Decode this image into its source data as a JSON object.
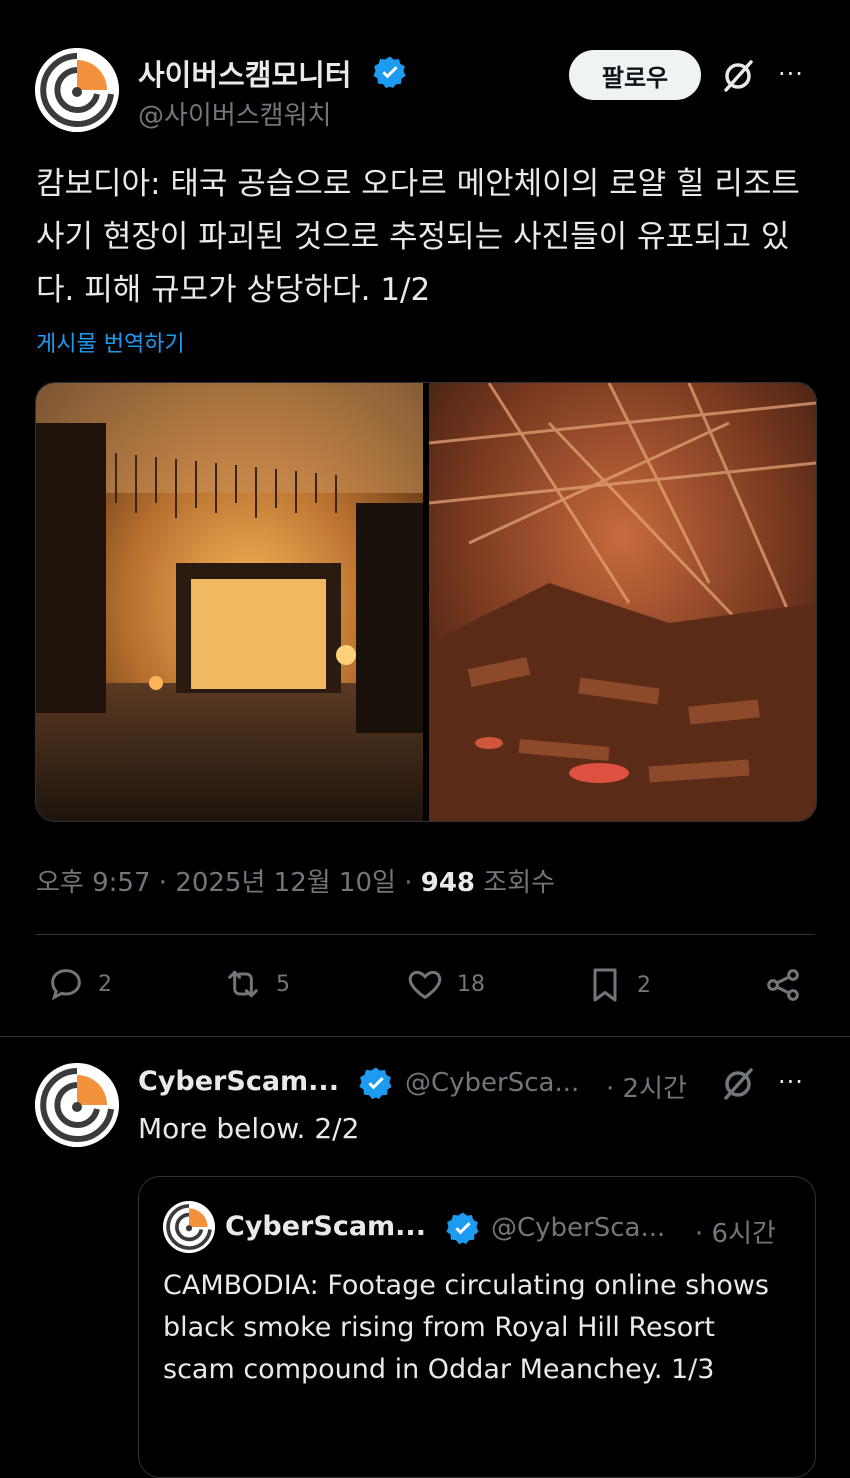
{
  "tweet": {
    "display_name": "사이버스캠모니터",
    "handle": "@사이버스캠워치",
    "follow_label": "팔로우",
    "more_label": "···",
    "text": "캄보디아: 태국 공습으로 오다르 메안체이의 로얄 힐 리조트 사기 현장이 파괴된 것으로 추정되는 사진들이 유포되고 있다. 피해 규모가 상당하다. 1/2",
    "translate_label": "게시물 번역하기",
    "time": "오후 9:57",
    "sep": "·",
    "date": "2025년 12월 10일",
    "views_count": "948",
    "views_label": "조회수",
    "actions": {
      "replies": "2",
      "reposts": "5",
      "likes": "18",
      "bookmarks": "2"
    }
  },
  "reply": {
    "display_name": "CyberScam...",
    "handle": "@CyberSca...",
    "time": "· 2시간",
    "more_label": "···",
    "text": "More below. 2/2",
    "quote": {
      "display_name": "CyberScam...",
      "handle": "@CyberSca...",
      "time": "· 6시간",
      "text": "CAMBODIA: Footage circulating online shows black smoke rising from Royal Hill Resort scam compound in Oddar Meanchey. 1/3"
    }
  },
  "colors": {
    "background": "#000000",
    "text": "#e7e9ea",
    "muted": "#71767b",
    "link": "#1d9bf0",
    "verified": "#1d9bf0",
    "logo_orange": "#f4913c"
  }
}
